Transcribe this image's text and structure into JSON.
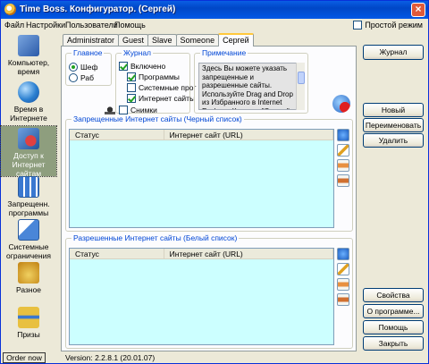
{
  "window": {
    "title": "Time Boss. Конфигуратор. (Сергей)"
  },
  "menu": [
    "Файл",
    "Настройки",
    "Пользователи",
    "Помощь"
  ],
  "simple_mode": {
    "label": "Простой режим",
    "checked": false
  },
  "sidebar": [
    {
      "label": "Компьютер, время",
      "icon": "computer-clock-icon",
      "active": false
    },
    {
      "label": "Время в Интернете",
      "icon": "globe-icon",
      "active": false
    },
    {
      "label": "Доступ к Интернет сайтам",
      "icon": "internet-access-icon",
      "active": true
    },
    {
      "label": "Запрещенн. программы",
      "icon": "forbidden-programs-icon",
      "active": false
    },
    {
      "label": "Системные ограничения",
      "icon": "system-restrictions-icon",
      "active": false
    },
    {
      "label": "Разное",
      "icon": "misc-icon",
      "active": false
    },
    {
      "label": "Призы",
      "icon": "prizes-icon",
      "active": false
    }
  ],
  "tabs": [
    "Administrator",
    "Guest",
    "Slave",
    "Someone",
    "Сергей"
  ],
  "active_tab": "Сергей",
  "main_group": {
    "title": "Главное",
    "options": [
      {
        "label": "Шеф",
        "checked": true
      },
      {
        "label": "Раб",
        "checked": false
      }
    ]
  },
  "journal_group": {
    "title": "Журнал",
    "enabled": {
      "label": "Включено",
      "checked": true
    },
    "options": [
      {
        "label": "Программы",
        "checked": true
      },
      {
        "label": "Системные прог",
        "checked": false
      },
      {
        "label": "Интернет сайты",
        "checked": true
      }
    ],
    "screenshots": {
      "label": "Снимки",
      "checked": false
    }
  },
  "note_group": {
    "title": "Примечание",
    "text": "Здесь Вы можете указать запрещенные и разрешенные сайты. Используйте Drag and Drop из Избранного в Internet Explorer. Колонка \"Статус\" включает и"
  },
  "blacklist": {
    "title": "Запрещенные Интернет сайты (Черный список)",
    "columns": [
      "Статус",
      "Интернет сайт (URL)"
    ],
    "rows": []
  },
  "whitelist": {
    "title": "Разрешенные Интернет сайты (Белый список)",
    "columns": [
      "Статус",
      "Интернет сайт (URL)"
    ],
    "rows": []
  },
  "right_buttons": {
    "journal": "Журнал",
    "new": "Новый",
    "rename": "Переименовать",
    "delete": "Удалить",
    "properties": "Свойства",
    "about": "О программе...",
    "help": "Помощь",
    "close": "Закрыть"
  },
  "status": {
    "order_label": "Order now",
    "version": "Version: 2.2.8.1 (20.01.07)"
  },
  "colors": {
    "table_bg": "#ccffff",
    "titlebar": "#0058e6",
    "group_title": "#0046d5",
    "active_side": "#8e9e7e"
  }
}
